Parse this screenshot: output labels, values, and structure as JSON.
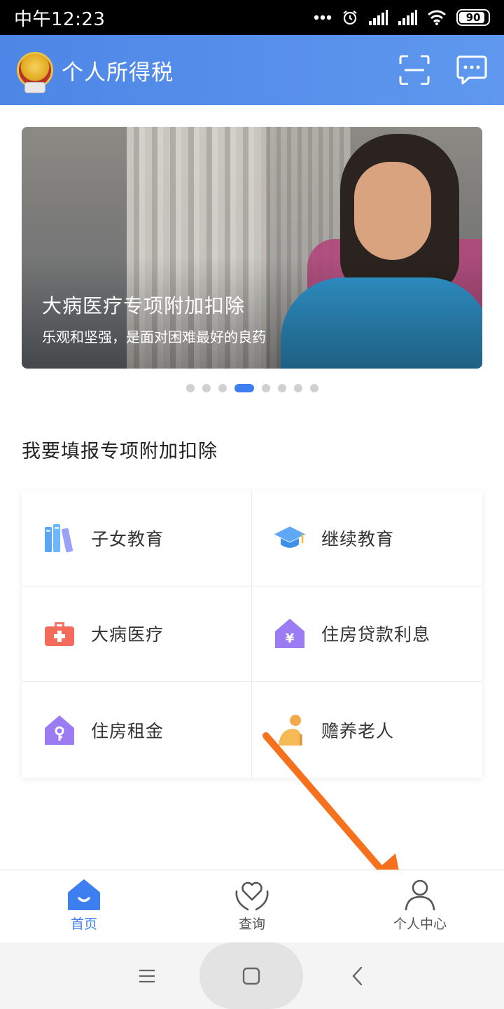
{
  "status_bar": {
    "time": "中午12:23",
    "battery": "90"
  },
  "header": {
    "title": "个人所得税",
    "emblem_icon": "national-emblem-icon",
    "scan_icon": "scan-icon",
    "message_icon": "message-icon"
  },
  "banner": {
    "title": "大病医疗专项附加扣除",
    "subtitle": "乐观和坚强，是面对困难最好的良药",
    "dots_total": 8,
    "active_index": 3
  },
  "section": {
    "title": "我要填报专项附加扣除"
  },
  "deductions": [
    {
      "label": "子女教育",
      "icon": "books-icon"
    },
    {
      "label": "继续教育",
      "icon": "graduation-cap-icon"
    },
    {
      "label": "大病医疗",
      "icon": "medical-kit-icon"
    },
    {
      "label": "住房贷款利息",
      "icon": "house-yuan-icon"
    },
    {
      "label": "住房租金",
      "icon": "house-key-icon"
    },
    {
      "label": "赡养老人",
      "icon": "elderly-person-icon"
    }
  ],
  "tabs": [
    {
      "label": "首页",
      "icon": "home-icon",
      "active": true
    },
    {
      "label": "查询",
      "icon": "heart-hands-icon",
      "active": false
    },
    {
      "label": "个人中心",
      "icon": "person-icon",
      "active": false
    }
  ],
  "colors": {
    "accent": "#3d7ff0",
    "header": "#4d86e6",
    "annotation_arrow": "#f5711e"
  }
}
